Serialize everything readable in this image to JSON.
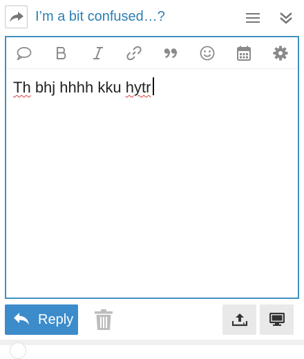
{
  "header": {
    "topic_title": "I’m a bit confused…?",
    "icons": [
      "share-reply-icon",
      "hamburger-menu-icon",
      "double-chevron-down-icon"
    ]
  },
  "toolbar": {
    "tools": [
      "quote-bubble-icon",
      "bold-icon",
      "italic-icon",
      "link-icon",
      "blockquote-icon",
      "emoji-icon",
      "calendar-icon",
      "gear-icon"
    ]
  },
  "editor": {
    "words": [
      "Th",
      "bhj",
      "hhhh",
      "kku",
      "hytr"
    ]
  },
  "actions": {
    "reply_label": "Reply"
  },
  "colors": {
    "accent": "#3c8ccc",
    "title": "#2c7fb3",
    "border_focus": "#3f90c1",
    "icon_gray": "#8a8a8a",
    "spell_error": "#d33333"
  }
}
